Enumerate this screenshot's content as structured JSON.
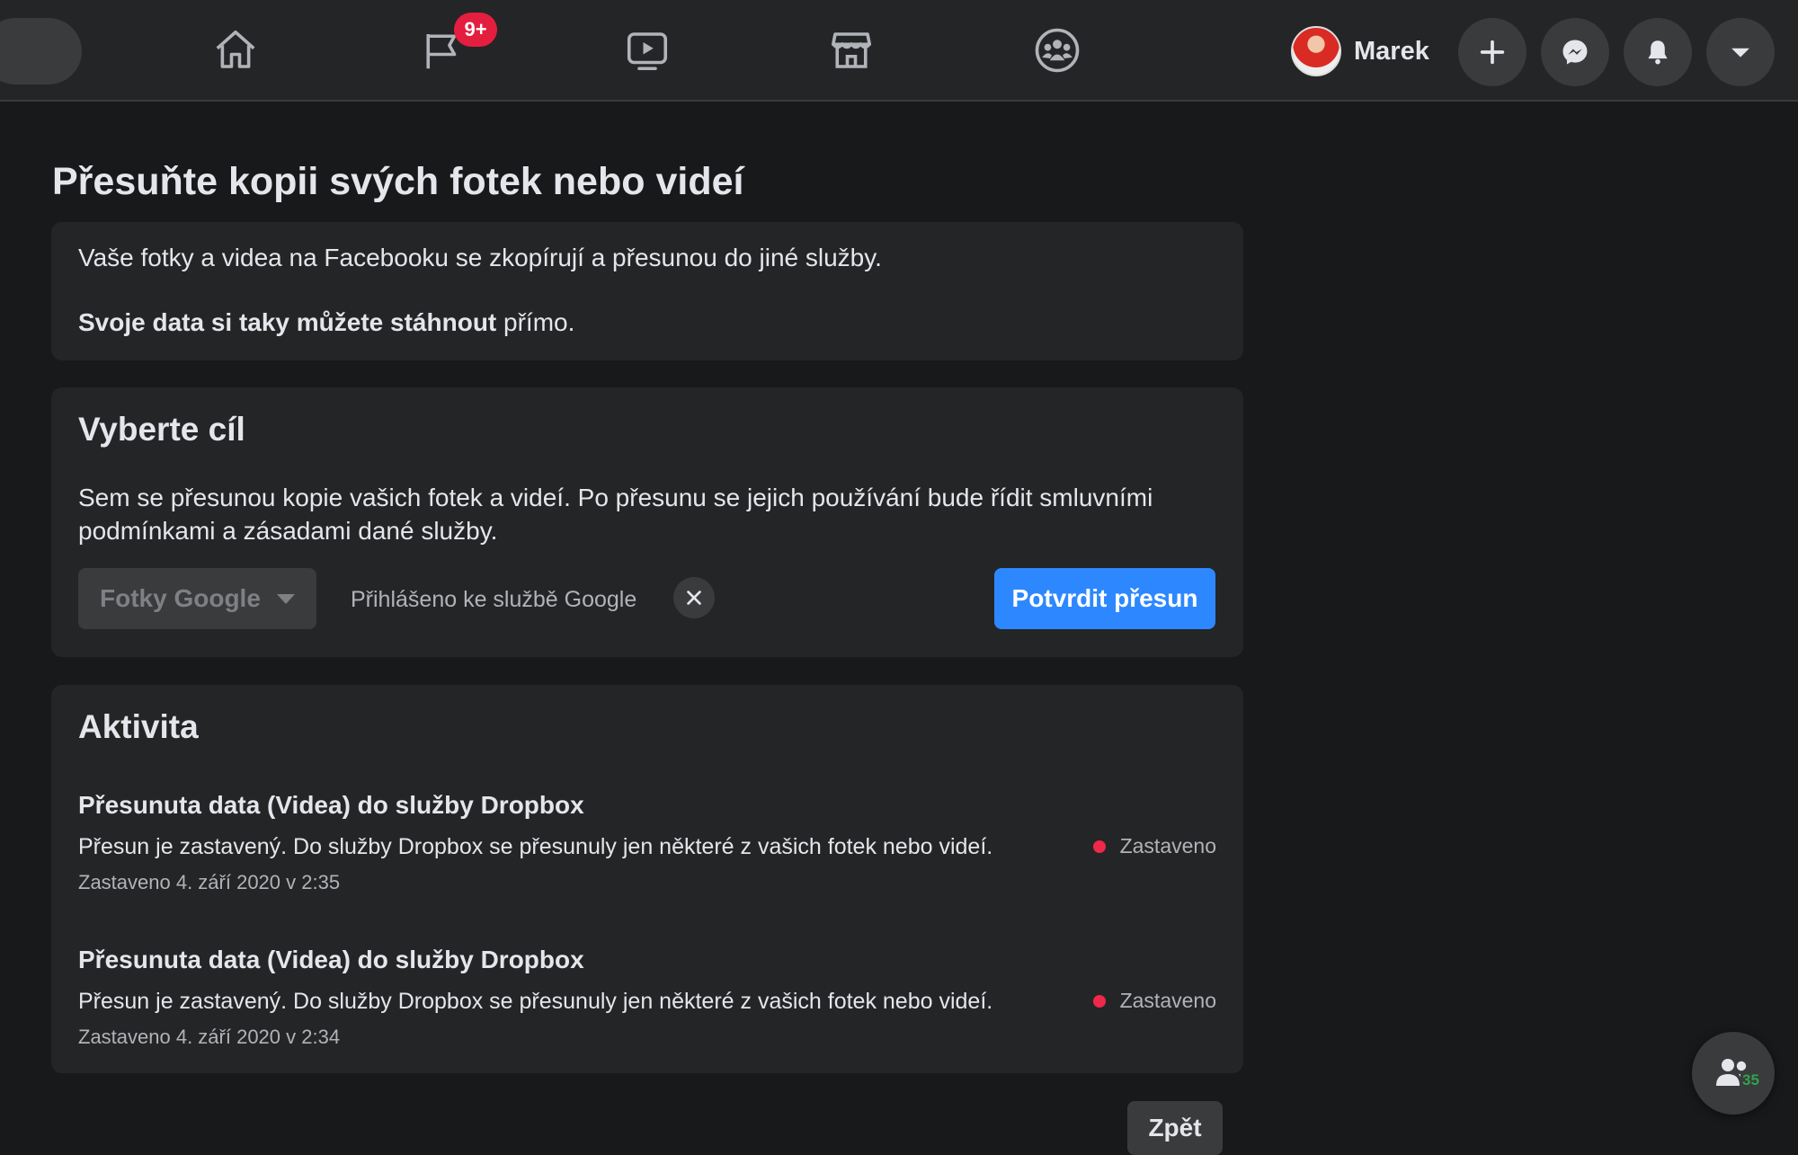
{
  "topbar": {
    "notification_badge": "9+",
    "profile_name": "Marek",
    "icons": [
      "home-icon",
      "pages-flag-icon",
      "watch-video-icon",
      "marketplace-icon",
      "groups-icon",
      "plus-icon",
      "messenger-icon",
      "bell-icon",
      "caret-down-icon"
    ]
  },
  "page": {
    "title": "Přesuňte kopii svých fotek nebo videí"
  },
  "intro": {
    "line1": "Vaše fotky a videa na Facebooku se zkopírují a přesunou do jiné služby.",
    "line2_strong": "Svoje data si taky můžete stáhnout",
    "line2_rest": " přímo."
  },
  "destination": {
    "heading": "Vyberte cíl",
    "description": "Sem se přesunou kopie vašich fotek a videí. Po přesunu se jejich používání bude řídit smluvními podmínkami a zásadami dané služby.",
    "selected_service": "Fotky Google",
    "signed_in_text": "Přihlášeno ke službě Google",
    "confirm_label": "Potvrdit přesun"
  },
  "activity": {
    "heading": "Aktivita",
    "items": [
      {
        "title": "Přesunuta data (Videa) do služby Dropbox",
        "description": "Přesun je zastavený. Do služby Dropbox se přesunuly jen některé z vašich fotek nebo videí.",
        "timestamp": "Zastaveno 4. září 2020 v 2:35",
        "status": "Zastaveno"
      },
      {
        "title": "Přesunuta data (Videa) do služby Dropbox",
        "description": "Přesun je zastavený. Do služby Dropbox se přesunuly jen některé z vašich fotek nebo videí.",
        "timestamp": "Zastaveno 4. září 2020 v 2:34",
        "status": "Zastaveno"
      }
    ]
  },
  "footer": {
    "back_label": "Zpět"
  },
  "contacts": {
    "online_count": "35"
  },
  "colors": {
    "background": "#18191a",
    "card": "#242526",
    "accent": "#2d88ff",
    "badge": "#e41e3f",
    "status_stopped": "#f02849"
  }
}
